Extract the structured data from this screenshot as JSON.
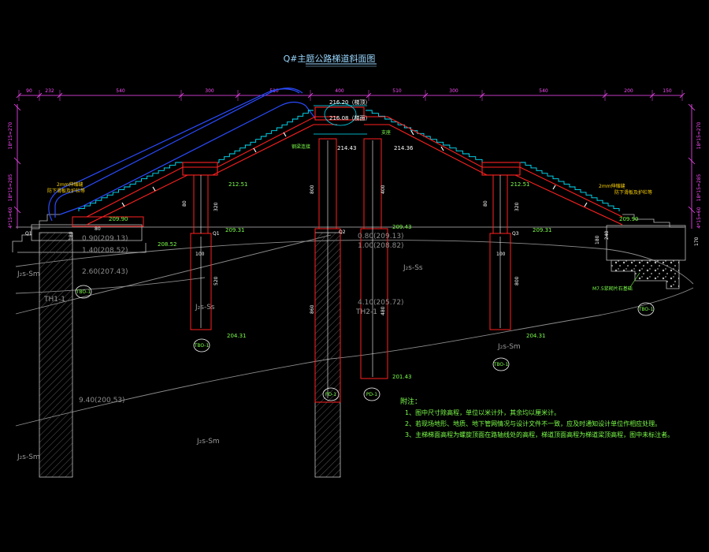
{
  "title": "Q#主题公路梯道斜面图",
  "colors": {
    "background": "#000000",
    "dimension": "#ff4dff",
    "structure": "#ff2020",
    "stairs": "#00e5ff",
    "escalator": "#2a4bff",
    "ground": "#9a9a9a",
    "text_green": "#7cff4a",
    "text_yellow": "#ffd400"
  },
  "dimensions_top": [
    "90",
    "232",
    "540",
    "300",
    "510",
    "400",
    "510",
    "300",
    "540",
    "200",
    "150"
  ],
  "dimensions_side_left": [
    "18*15=270",
    "18*15=285",
    "4*15=60"
  ],
  "dimensions_side_right": [
    "18*15=270",
    "18*15=285",
    "4*15=60"
  ],
  "elevations": {
    "top_deck": "216.20（梯顶）",
    "deck2": "216.08（梯面）",
    "deck_left": "214.43",
    "deck_right": "214.36",
    "left_landing": "212.51",
    "right_landing": "212.51",
    "left_end": "209.90",
    "right_end": "209.90",
    "left_pier_top": "209.31",
    "center_top": "209.43",
    "right_pier_top": "209.31",
    "left_foot": "208.52",
    "left_pier_bottom": "204.31",
    "right_pier_bottom": "204.31",
    "center_pile_bottom": "201.43"
  },
  "strata": [
    {
      "label": "J₂s-Sm"
    },
    {
      "label": "J₂s-Ss"
    },
    {
      "label": "J₂s-Ss"
    },
    {
      "label": "J₂s-Sm"
    },
    {
      "label": "J₂s-Sm"
    },
    {
      "label": "J₂s-Sm"
    }
  ],
  "depth_labels": [
    "0.90(209.13)",
    "1.40(208.52)",
    "2.60(207.43)",
    "9.40(200.53)",
    "0.80(209.13)",
    "1.00(208.82)",
    "4.10(205.72)"
  ],
  "boreholes": [
    "TH1-1",
    "TH2-1"
  ],
  "markers": [
    "TBO-1",
    "TBO-1",
    "TBO-1",
    "TBO-1",
    "PD-1",
    "PD-1"
  ],
  "pier_labels": [
    "Q1",
    "Q1",
    "Q2",
    "Q3"
  ],
  "annotations": {
    "left_top": [
      "2mm伸缩缝",
      "防下滑板及护栏等",
      "详见大样"
    ],
    "right_top": [
      "2mm伸缩缝",
      "防下滑板及护栏等",
      "详见大样"
    ],
    "center_left": "钢梁连接",
    "center_right": "支座",
    "concrete": "M7.5浆砌片石基础"
  },
  "pile_sizes": [
    "80",
    "320",
    "520",
    "100",
    "800",
    "400",
    "480",
    "860",
    "100",
    "80",
    "320",
    "800",
    "180",
    "240",
    "170",
    "80",
    "180"
  ],
  "notes": {
    "title": "附注：",
    "items": [
      "1、图中尺寸除高程，单位以米计外，其余均以厘米计。",
      "2、若现场地形、地质、地下管网情况与设计文件不一致，应及时通知设计单位作相应处理。",
      "3、主梯梯面高程为螺旋顶面在路轴线处的高程，梯道顶面高程为梯道梁顶高程，图中未标注者。"
    ]
  }
}
